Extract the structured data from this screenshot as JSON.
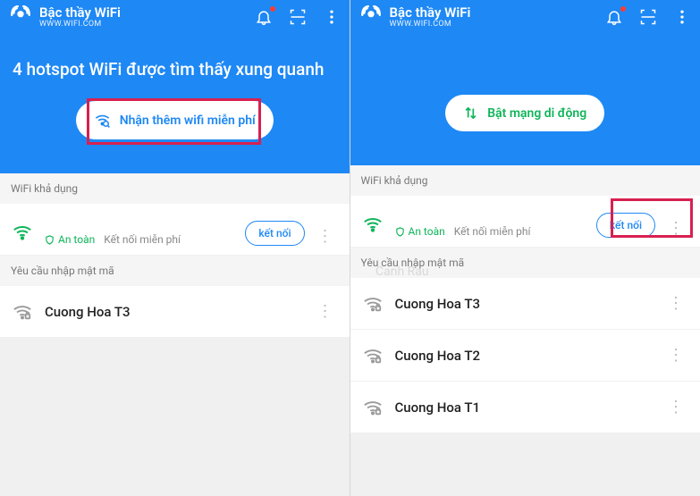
{
  "app": {
    "title": "Bậc thầy WiFi",
    "subtitle": "WWW.WIFI.COM"
  },
  "left": {
    "headline": "4 hotspot WiFi được tìm thấy xung quanh",
    "cta": "Nhận thêm wifi miễn phí",
    "sections": {
      "available": "WiFi khả dụng",
      "password": "Yêu cầu nhập mật mã"
    },
    "safe_row": {
      "safe": "An toàn",
      "free": "Kết nối miễn phí",
      "btn": "kết nối"
    },
    "networks": [
      {
        "name": "Cuong Hoa T3"
      }
    ]
  },
  "right": {
    "cta": "Bật mạng di động",
    "sections": {
      "available": "WiFi khả dụng",
      "password": "Yêu cầu nhập mật mã"
    },
    "safe_row": {
      "safe": "An toàn",
      "free": "Kết nối miễn phí",
      "btn": "kết nối"
    },
    "networks": [
      {
        "name": "Cuong Hoa T3"
      },
      {
        "name": "Cuong Hoa T2"
      },
      {
        "name": "Cuong Hoa T1"
      }
    ]
  },
  "watermark": "Canh Rau"
}
